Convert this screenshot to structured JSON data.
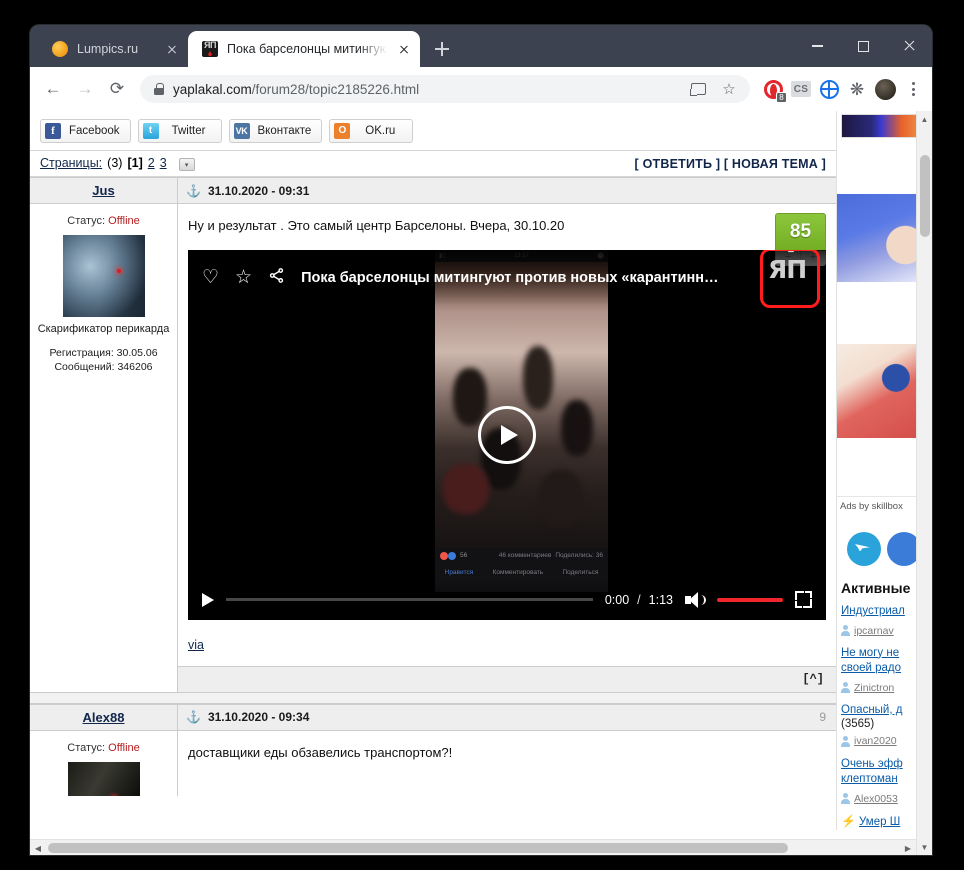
{
  "browser": {
    "tabs": [
      {
        "title": "Lumpics.ru",
        "favicon": "lumpics-favicon",
        "active": false
      },
      {
        "title": "Пока барселонцы митингуют пр",
        "favicon": "yaplakal-favicon",
        "active": true
      }
    ],
    "new_tab_label": "+",
    "window_controls": {
      "minimize": "minimize",
      "maximize": "maximize",
      "close": "close"
    },
    "toolbar": {
      "back": "←",
      "forward": "→",
      "reload": "⟳",
      "url_domain": "yaplakal.com",
      "url_path": "/forum28/topic2185226.html",
      "lock": "secure-lock",
      "cast": "cast-icon",
      "bookmark": "☆",
      "extensions": [
        {
          "name": "opera-gx-extension",
          "badge": "8"
        },
        {
          "name": "cs-extension",
          "label": "CS"
        },
        {
          "name": "globe-extension"
        },
        {
          "name": "puzzle-extensions",
          "label": "✶"
        }
      ],
      "profile": "profile-avatar",
      "menu": "chrome-menu"
    }
  },
  "page": {
    "social_buttons": [
      {
        "label": "Facebook",
        "icon": "facebook-icon",
        "glyph": "f"
      },
      {
        "label": "Twitter",
        "icon": "twitter-icon",
        "glyph": "t"
      },
      {
        "label": "Вконтакте",
        "icon": "vk-icon",
        "glyph": "vk"
      },
      {
        "label": "OK.ru",
        "icon": "ok-icon",
        "glyph": "O"
      }
    ],
    "pages_bar": {
      "label": "Страницы:",
      "count": "(3)",
      "current": "[1]",
      "others": [
        "2",
        "3"
      ],
      "dropdown": "▾"
    },
    "actions": {
      "reply": "[ ОТВЕТИТЬ ]",
      "new_topic": "[ НОВАЯ ТЕМА ]"
    },
    "posts": [
      {
        "username": "Jus",
        "status_label": "Статус:",
        "status_value": "Offline",
        "usertitle": "Скарификатор перикарда",
        "registration": "Регистрация: 30.05.06",
        "messages": "Сообщений: 346206",
        "date": "31.10.2020 - 09:31",
        "anchor": "⚓",
        "text": "Ну и результат . Это самый центр Барселоны. Вчера, 30.10.20",
        "rating": "85",
        "rating_minus": "−",
        "rating_plus": "+",
        "via_label": "via",
        "foot_label": "[^]"
      },
      {
        "username": "Alex88",
        "status_label": "Статус:",
        "status_value": "Offline",
        "date": "31.10.2020 - 09:34",
        "anchor": "⚓",
        "text": "доставщики еды обзавелись транспортом?!",
        "post_number": "9"
      }
    ],
    "video": {
      "title": "Пока барселонцы митингуют против новых «карантинн…",
      "like_icon": "♡",
      "favorite_icon": "☆",
      "share_icon": "share-icon",
      "logo_text": "ЯП",
      "logo_highlighted": true,
      "highlight_color": "#ff1d1d",
      "play_label": "play",
      "current_time": "0:00",
      "separator": "/",
      "duration": "1:13",
      "volume_icon": "volume-icon",
      "fullscreen_icon": "fullscreen-icon",
      "overlay_frame": {
        "reactions": "56",
        "comments": "46 комментариев",
        "shares": "Поделились: 36",
        "action_like": "Нравится",
        "action_comment": "Комментировать",
        "action_share": "Поделиться"
      }
    },
    "sidebar": {
      "ads_by": "Ads by skillbox",
      "active_title": "Активные",
      "topics": [
        {
          "title": "Индустриал",
          "author": "ipcarnav",
          "count": ""
        },
        {
          "title": "Не могу не",
          "title2": "своей радо",
          "author": "Zinictron",
          "count": ""
        },
        {
          "title": "Опасный, д",
          "author": "ivan2020",
          "count": "(3565)"
        },
        {
          "title": "Очень эфф",
          "title2": "клептоман",
          "author": "Alex0053",
          "count": ""
        },
        {
          "title": "Умер Ш",
          "author": "",
          "count": "",
          "hot": true
        }
      ]
    }
  }
}
